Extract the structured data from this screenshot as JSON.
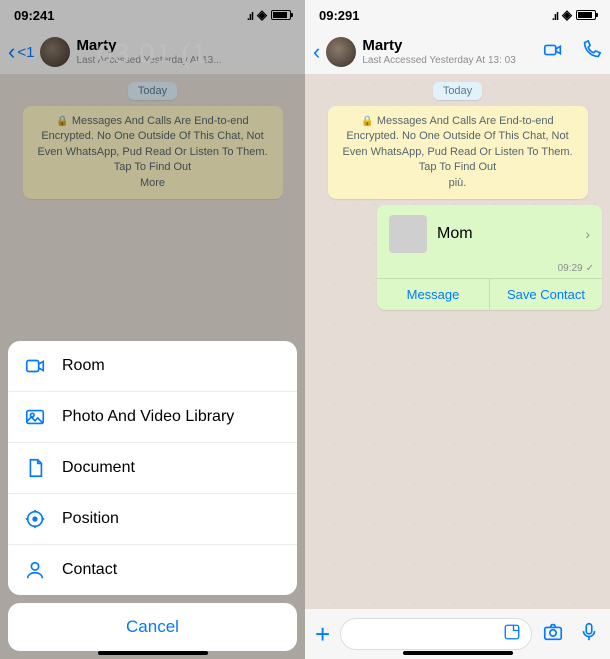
{
  "left": {
    "status_time": "09:241",
    "back_count": "<1",
    "contact": "Marty",
    "last_access": "Last Accessed Yesterday At 13...",
    "watermark": "03 01 (1",
    "date_pill": "Today",
    "encryption": "Messages And Calls Are End-to-end Encrypted. No One Outside Of This Chat, Not Even WhatsApp, Pud Read Or Listen To Them. Tap To Find Out",
    "encryption_more": "More",
    "sheet": {
      "room": "Room",
      "photo": "Photo And Video Library",
      "document": "Document",
      "position": "Position",
      "contact": "Contact",
      "cancel": "Cancel"
    }
  },
  "right": {
    "status_time": "09:291",
    "contact": "Marty",
    "last_access": "Last Accessed Yesterday At 13: 03",
    "date_pill": "Today",
    "encryption": "Messages And Calls Are End-to-end Encrypted. No One Outside Of This Chat, Not Even WhatsApp, Pud Read Or Listen To Them. Tap To Find Out",
    "encryption_more": "più.",
    "card": {
      "name": "Mom",
      "time": "09:29",
      "message": "Message",
      "save": "Save Contact"
    }
  }
}
